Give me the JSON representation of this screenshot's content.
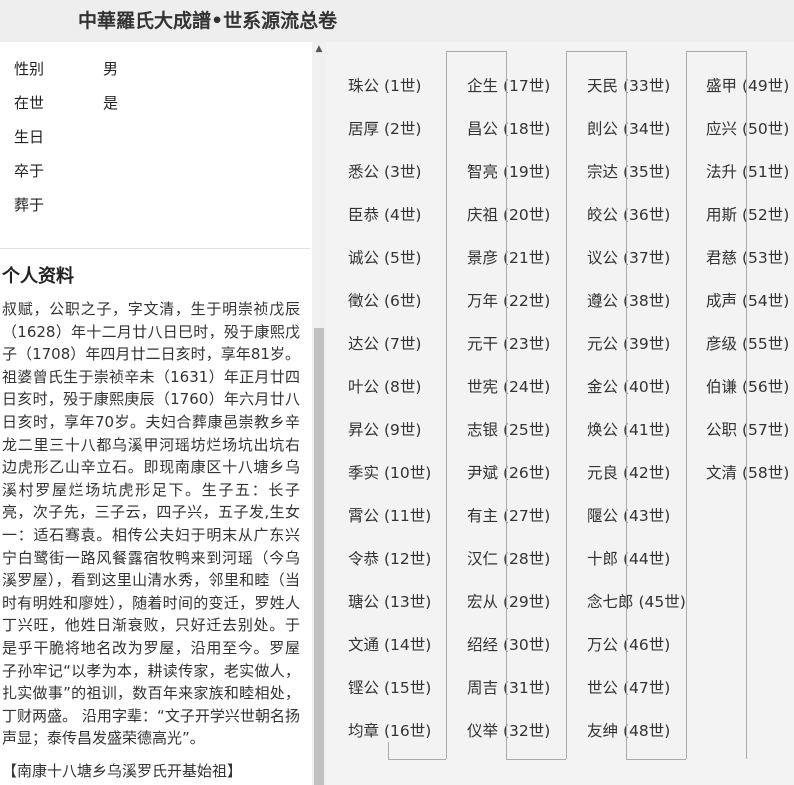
{
  "header": {
    "title": "中華羅氏大成譜•世系源流总卷"
  },
  "person": {
    "fields": [
      {
        "label": "性别",
        "value": "男"
      },
      {
        "label": "在世",
        "value": "是"
      },
      {
        "label": "生日",
        "value": ""
      },
      {
        "label": "卒于",
        "value": ""
      },
      {
        "label": "葬于",
        "value": ""
      }
    ],
    "section_title": "个人资料",
    "bio": "叔赋，公职之子，字文清，生于明崇祯戊辰（1628）年十二月廿八日巳时，殁于康熙戊子（1708）年四月廿二日亥时，享年81岁。祖婆曾氏生于崇祯辛未（1631）年正月廿四日亥时，殁于康熙庚辰（1760）年六月廿八日亥时，享年70岁。夫妇合葬康邑崇教乡辛龙二里三十八都乌溪甲河瑶坊烂场坑出坑右边虎形乙山辛立石。即现南康区十八塘乡乌溪村罗屋烂场坑虎形足下。生子五：长子亮，次子先，三子云，四子兴，五子发,生女一：适石骞袁。相传公夫妇于明末从广东兴宁白鹭街一路风餐露宿牧鸭来到河瑶（今乌溪罗屋），看到这里山清水秀，邻里和睦（当时有明姓和廖姓），随着时间的变迁，罗姓人丁兴旺，他姓日渐衰败，只好迁去别处。于是乎干脆将地名改为罗屋，沿用至今。罗屋子孙牢记“以孝为本，耕读传家，老实做人，扎实做事”的祖训，数百年来家族和睦相处，丁财两盛。 沿用字辈：“文子开学兴世朝名扬声显；泰传昌发盛荣德高光”。",
    "bio_footer": "【南康十八塘乡乌溪罗氏开基始祖】"
  },
  "generations": {
    "columns": [
      [
        {
          "name": "珠公",
          "gen": "(1世)"
        },
        {
          "name": "居厚",
          "gen": "(2世)"
        },
        {
          "name": "悉公",
          "gen": "(3世)"
        },
        {
          "name": "臣恭",
          "gen": "(4世)"
        },
        {
          "name": "诚公",
          "gen": "(5世)"
        },
        {
          "name": "徵公",
          "gen": "(6世)"
        },
        {
          "name": "达公",
          "gen": "(7世)"
        },
        {
          "name": "叶公",
          "gen": "(8世)"
        },
        {
          "name": "昇公",
          "gen": "(9世)"
        },
        {
          "name": "季实",
          "gen": "(10世)"
        },
        {
          "name": "霄公",
          "gen": "(11世)"
        },
        {
          "name": "令恭",
          "gen": "(12世)"
        },
        {
          "name": "瑭公",
          "gen": "(13世)"
        },
        {
          "name": "文通",
          "gen": "(14世)"
        },
        {
          "name": "铿公",
          "gen": "(15世)"
        },
        {
          "name": "均章",
          "gen": "(16世)"
        }
      ],
      [
        {
          "name": "企生",
          "gen": "(17世)"
        },
        {
          "name": "昌公",
          "gen": "(18世)"
        },
        {
          "name": "智亮",
          "gen": "(19世)"
        },
        {
          "name": "庆祖",
          "gen": "(20世)"
        },
        {
          "name": "景彦",
          "gen": "(21世)"
        },
        {
          "name": "万年",
          "gen": "(22世)"
        },
        {
          "name": "元干",
          "gen": "(23世)"
        },
        {
          "name": "世宪",
          "gen": "(24世)"
        },
        {
          "name": "志银",
          "gen": "(25世)"
        },
        {
          "name": "尹斌",
          "gen": "(26世)"
        },
        {
          "name": "有主",
          "gen": "(27世)"
        },
        {
          "name": "汉仁",
          "gen": "(28世)"
        },
        {
          "name": "宏从",
          "gen": "(29世)"
        },
        {
          "name": "绍经",
          "gen": "(30世)"
        },
        {
          "name": "周吉",
          "gen": "(31世)"
        },
        {
          "name": "仪举",
          "gen": "(32世)"
        }
      ],
      [
        {
          "name": "天民",
          "gen": "(33世)"
        },
        {
          "name": "剆公",
          "gen": "(34世)"
        },
        {
          "name": "宗达",
          "gen": "(35世)"
        },
        {
          "name": "皎公",
          "gen": "(36世)"
        },
        {
          "name": "议公",
          "gen": "(37世)"
        },
        {
          "name": "遵公",
          "gen": "(38世)"
        },
        {
          "name": "元公",
          "gen": "(39世)"
        },
        {
          "name": "金公",
          "gen": "(40世)"
        },
        {
          "name": "焕公",
          "gen": "(41世)"
        },
        {
          "name": "元良",
          "gen": "(42世)"
        },
        {
          "name": "隁公",
          "gen": "(43世)"
        },
        {
          "name": "十郎",
          "gen": "(44世)"
        },
        {
          "name": "念七郎",
          "gen": "(45世)"
        },
        {
          "name": "万公",
          "gen": "(46世)"
        },
        {
          "name": "世公",
          "gen": "(47世)"
        },
        {
          "name": "友绅",
          "gen": "(48世)"
        }
      ],
      [
        {
          "name": "盛甲",
          "gen": "(49世)"
        },
        {
          "name": "应兴",
          "gen": "(50世)"
        },
        {
          "name": "法升",
          "gen": "(51世)"
        },
        {
          "name": "用斯",
          "gen": "(52世)"
        },
        {
          "name": "君慈",
          "gen": "(53世)"
        },
        {
          "name": "成声",
          "gen": "(54世)"
        },
        {
          "name": "彦级",
          "gen": "(55世)"
        },
        {
          "name": "伯谦",
          "gen": "(56世)"
        },
        {
          "name": "公职",
          "gen": "(57世)"
        },
        {
          "name": "文清",
          "gen": "(58世)"
        }
      ]
    ]
  }
}
